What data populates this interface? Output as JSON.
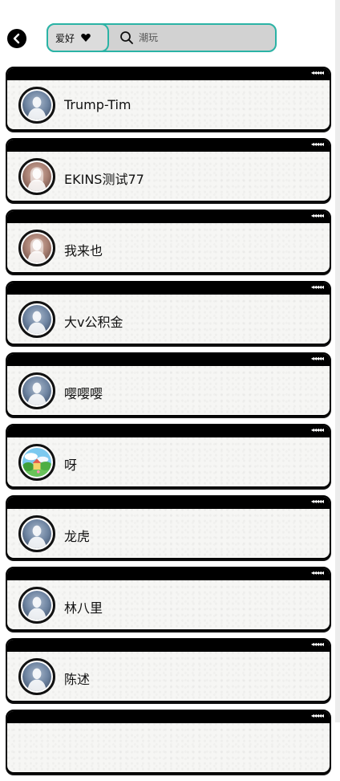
{
  "header": {
    "category_label": "爱好",
    "search_placeholder": "潮玩"
  },
  "theme": {
    "accent": "#2bb3a5",
    "card_border": "#000000",
    "card_bg": "#f6f6f4",
    "search_bg": "#d2d2d2"
  },
  "users": [
    {
      "name": "Trump-Tim",
      "avatar": "default-male-avatar-icon"
    },
    {
      "name": "EKINS测试77",
      "avatar": "default-female-avatar-icon"
    },
    {
      "name": "我来也",
      "avatar": "default-female-avatar-icon"
    },
    {
      "name": "大v公积金",
      "avatar": "default-male-avatar-icon"
    },
    {
      "name": "嘤嘤嘤",
      "avatar": "default-male-avatar-icon"
    },
    {
      "name": "呀",
      "avatar": "landscape-photo-avatar-icon"
    },
    {
      "name": "龙虎",
      "avatar": "default-male-avatar-icon"
    },
    {
      "name": "林八里",
      "avatar": "default-male-avatar-icon"
    },
    {
      "name": "陈述",
      "avatar": "default-male-avatar-icon"
    }
  ]
}
